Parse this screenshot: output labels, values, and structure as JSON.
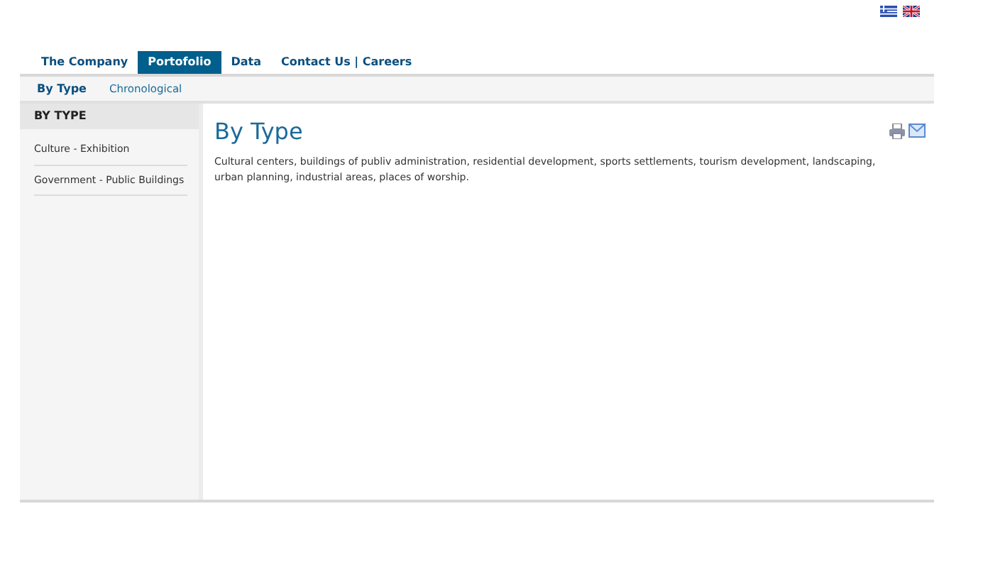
{
  "languages": [
    {
      "kind": "greek"
    },
    {
      "kind": "english"
    }
  ],
  "tabs": [
    {
      "label": "The Company",
      "selected": false
    },
    {
      "label": "Portofolio",
      "selected": true
    },
    {
      "label": "Data",
      "selected": false
    },
    {
      "label": "Contact Us | Careers",
      "selected": false
    }
  ],
  "subtabs": [
    {
      "label": "By Type",
      "selected": true
    },
    {
      "label": "Chronological",
      "selected": false
    }
  ],
  "sidebar": {
    "heading": "BY TYPE",
    "items": [
      "Culture - Exhibition",
      "Government - Public Buildings"
    ]
  },
  "content": {
    "title": "By Type",
    "text": "Cultural centers, buildings of publiv administration, residential development, sports settlements, tourism development, landscaping, urban planning, industrial areas, places of worship."
  }
}
